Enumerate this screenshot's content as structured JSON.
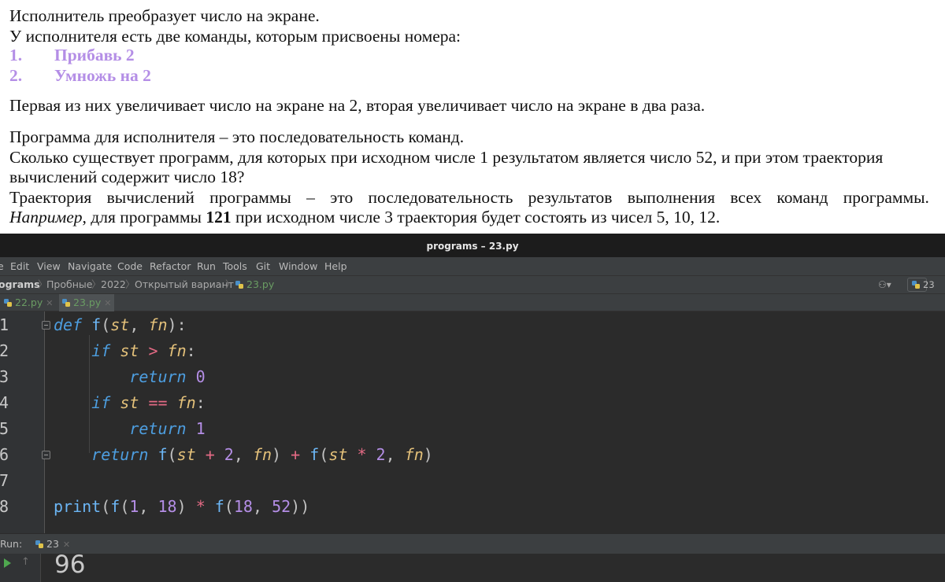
{
  "task": {
    "line1": "Исполнитель преобразует число на экране.",
    "line2": "У исполнителя есть две команды, которым присвоены номера:",
    "commands": [
      {
        "num": "1.",
        "label": "Прибавь 2"
      },
      {
        "num": "2.",
        "label": "Умножь на 2"
      }
    ],
    "line5": "Первая из них увеличивает число на экране на 2, вторая увеличивает число на экране в два раза.",
    "line6": "Программа для исполнителя – это последовательность команд.",
    "line7": "Сколько существует программ, для которых при исходном числе 1 результатом является число 52, и при этом траектория",
    "line8": "вычислений содержит число 18?",
    "line9": "Траектория вычислений программы – это последовательность результатов выполнения всех команд программы.",
    "line10_italic": "Например",
    "line10_a": ", для программы ",
    "line10_bold": "121",
    "line10_b": " при исходном числе 3 траектория будет состоять из чисел 5, 10, 12."
  },
  "ide": {
    "title": "programs – 23.py",
    "menu": [
      "e",
      "Edit",
      "View",
      "Navigate",
      "Code",
      "Refactor",
      "Run",
      "Tools",
      "Git",
      "Window",
      "Help"
    ],
    "breadcrumb": [
      "ograms",
      "Пробные",
      "2022",
      "Открытый вариант",
      "23.py"
    ],
    "run_config": "23",
    "tabs": [
      {
        "label": "22.py",
        "active": false
      },
      {
        "label": "23.py",
        "active": true
      }
    ],
    "line_numbers": [
      "1",
      "2",
      "3",
      "4",
      "5",
      "6",
      "7",
      "8"
    ],
    "run_label": "Run:",
    "run_tab": "23",
    "output": "96"
  }
}
